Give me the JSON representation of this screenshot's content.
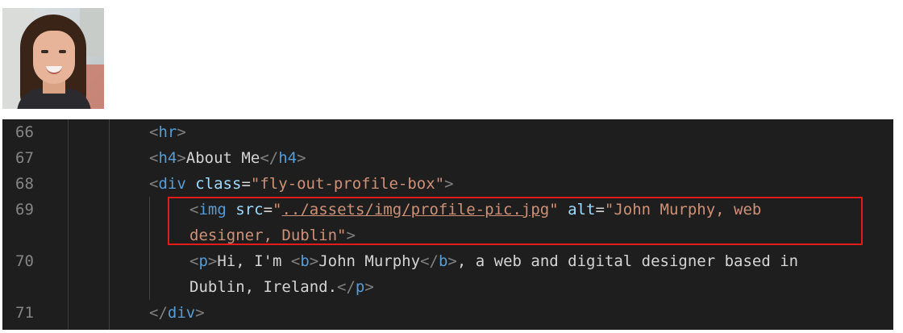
{
  "profile_image": {
    "icon": "profile-photo"
  },
  "editor": {
    "lines": [
      {
        "number": "66",
        "hr_tag": "hr"
      },
      {
        "number": "67",
        "open_tag": "h4",
        "text": "About Me",
        "close_tag": "h4"
      },
      {
        "number": "68",
        "tag": "div",
        "attr": "class",
        "value": "\"fly-out-profile-box\""
      },
      {
        "number": "69",
        "tag": "img",
        "src_attr": "src",
        "src_value": "../assets/img/profile-pic.jpg",
        "alt_attr": "alt",
        "alt_value_part1": "\"John Murphy, web",
        "alt_value_part2": "designer, Dublin\""
      },
      {
        "number": "70",
        "p_tag": "p",
        "text1": "Hi, I'm ",
        "b_tag": "b",
        "b_text": "John Murphy",
        "text2": ", a web and digital designer based in",
        "text3": "Dublin, Ireland."
      },
      {
        "number": "71",
        "close_tag": "div"
      }
    ]
  },
  "colors": {
    "highlight_border": "#e51a1a",
    "editor_bg": "#1e1e1e",
    "tag": "#569cd6",
    "attr": "#9cdcfe",
    "string": "#ce9178"
  }
}
